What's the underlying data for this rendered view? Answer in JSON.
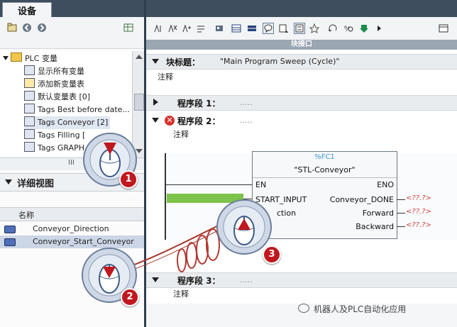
{
  "left_panel": {
    "tab_label": "设备",
    "tree": {
      "root": "PLC 变量",
      "items": [
        "显示所有变量",
        "添加新变量表",
        "默认变量表 [0]",
        "Tags Best before date...",
        "Tags Conveyor [2]",
        "Tags Filling [",
        "Tags GRAPH"
      ]
    },
    "hscroll_glyph": "III",
    "detail_view": {
      "title": "详细视图",
      "column_header": "名称",
      "rows": [
        "Conveyor_Direction",
        "Conveyor_Start_Conveyor"
      ]
    }
  },
  "editor": {
    "interface_label": "块接口",
    "block_title_label": "块标题：",
    "block_title_value": "\"Main Program Sweep (Cycle)\"",
    "block_comment": "注释",
    "networks": [
      {
        "label": "程序段 1：",
        "dots": "....."
      },
      {
        "label": "程序段 2：",
        "dots": ".....",
        "comment": "注释",
        "error_icon": "error-x-icon"
      },
      {
        "label": "程序段 3：",
        "dots": ".....",
        "comment": "注释"
      }
    ],
    "fc_block": {
      "tag": "%FC1",
      "name": "\"STL-Conveyor\"",
      "inputs": [
        "EN",
        "START_INPUT",
        "ction"
      ],
      "outputs": [
        "ENO",
        "Conveyor_DONE",
        "Forward",
        "Backward"
      ],
      "output_values": [
        "<??.?>",
        "<??.?>",
        "<??.?>"
      ]
    }
  },
  "callouts": [
    "1",
    "2",
    "3"
  ],
  "watermark": "机器人及PLC自动化应用",
  "colors": {
    "accent_green": "#7dc24a",
    "error_red": "#d9302c",
    "badge_red": "#c0181f",
    "fc_tag_blue": "#3a9ad0"
  }
}
